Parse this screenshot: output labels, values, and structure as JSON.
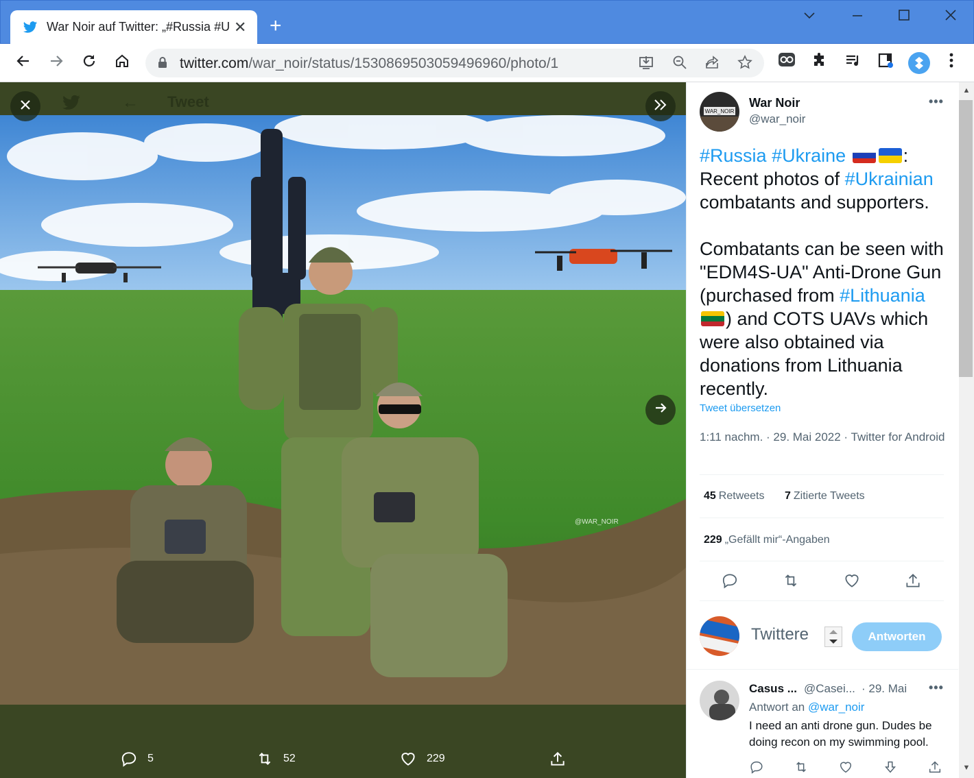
{
  "browser": {
    "tab_title": "War Noir auf Twitter: „#Russia #U",
    "tab_close": "✕",
    "new_tab": "+",
    "url_host": "twitter.com",
    "url_path": "/war_noir/status/1530869503059496960/photo/1",
    "window_controls": [
      "minimize",
      "restore",
      "close"
    ]
  },
  "viewer": {
    "header_ghost_title": "Tweet",
    "watermark": "@WAR_NOIR",
    "actions": [
      {
        "icon": "reply-icon",
        "count": "5"
      },
      {
        "icon": "retweet-icon",
        "count": "52"
      },
      {
        "icon": "like-icon",
        "count": "229"
      },
      {
        "icon": "share-icon",
        "count": ""
      }
    ]
  },
  "tweet": {
    "author_name": "War Noir",
    "author_handle": "@war_noir",
    "avatar_label": "WAR_NOIR",
    "more": "•••",
    "text": {
      "tag_russia": "#Russia",
      "tag_ukraine": "#Ukraine",
      "colon": ":",
      "line2a": "Recent photos of ",
      "tag_ukrainian": "#Ukrainian",
      "line3": "combatants and supporters.",
      "para2a": "Combatants can be seen with \"EDM4S-UA\" Anti-Drone Gun (purchased from ",
      "tag_lithuania": "#Lithuania",
      "para2b": ") and COTS UAVs which were also obtained via donations from Lithuania recently."
    },
    "translate": "Tweet übersetzen",
    "timestamp": "1:11 nachm. · 29. Mai 2022 · Twitter for Android",
    "retweets_count": "45",
    "retweets_label": "Retweets",
    "quotes_count": "7",
    "quotes_label": "Zitierte Tweets",
    "likes_count": "229",
    "likes_label": "„Gefällt mir“-Angaben"
  },
  "compose": {
    "placeholder": "Twittere",
    "reply_button": "Antworten"
  },
  "reply": {
    "name": "Casus ...",
    "handle": "@Casei...",
    "date": "· 29. Mai",
    "to_prefix": "Antwort an ",
    "to_handle": "@war_noir",
    "text": "I need an anti drone gun. Dudes be doing recon on my swimming pool."
  },
  "colors": {
    "titlebar": "#4f8ae0",
    "twitter_blue": "#1d9bf0",
    "viewer_bg": "#3a4623"
  }
}
